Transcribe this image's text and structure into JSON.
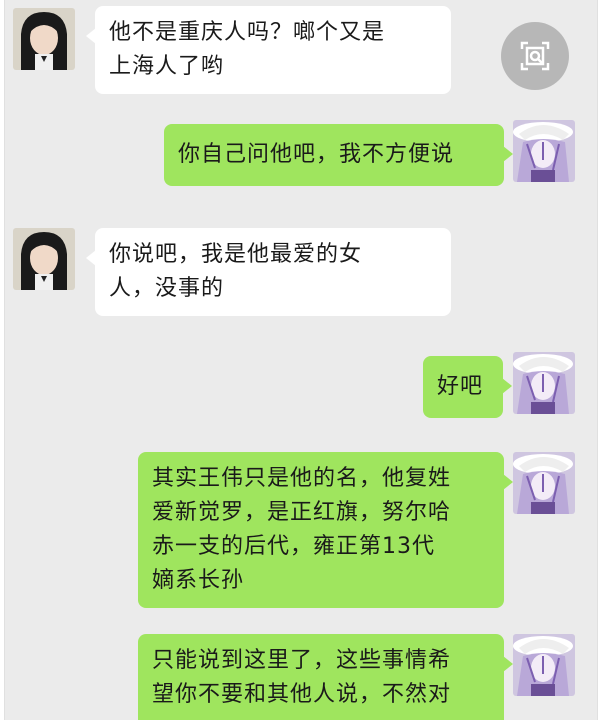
{
  "messages": [
    {
      "side": "in",
      "avatar": "girl-avatar",
      "lines": [
        "他不是重庆人吗？啷个又是",
        "上海人了哟"
      ]
    },
    {
      "side": "out",
      "avatar": "anime-avatar",
      "lines": [
        "你自己问他吧，我不方便说"
      ]
    },
    {
      "side": "in",
      "avatar": "girl-avatar",
      "lines": [
        "你说吧，我是他最爱的女",
        "人，没事的"
      ]
    },
    {
      "side": "out",
      "avatar": "anime-avatar",
      "lines": [
        "好吧"
      ]
    },
    {
      "side": "out",
      "avatar": "anime-avatar",
      "lines": [
        "其实王伟只是他的名，他复姓",
        "爱新觉罗，是正红旗，努尔哈",
        "赤一支的后代，雍正第13代",
        "嫡系长孙"
      ]
    },
    {
      "side": "out",
      "avatar": "anime-avatar",
      "lines": [
        "只能说到这里了，这些事情希",
        "望你不要和其他人说，不然对"
      ]
    }
  ],
  "overlay": {
    "icon": "search-image-icon"
  },
  "colors": {
    "chat_bg": "#ebebeb",
    "incoming": "#ffffff",
    "outgoing": "#9fe55e"
  }
}
